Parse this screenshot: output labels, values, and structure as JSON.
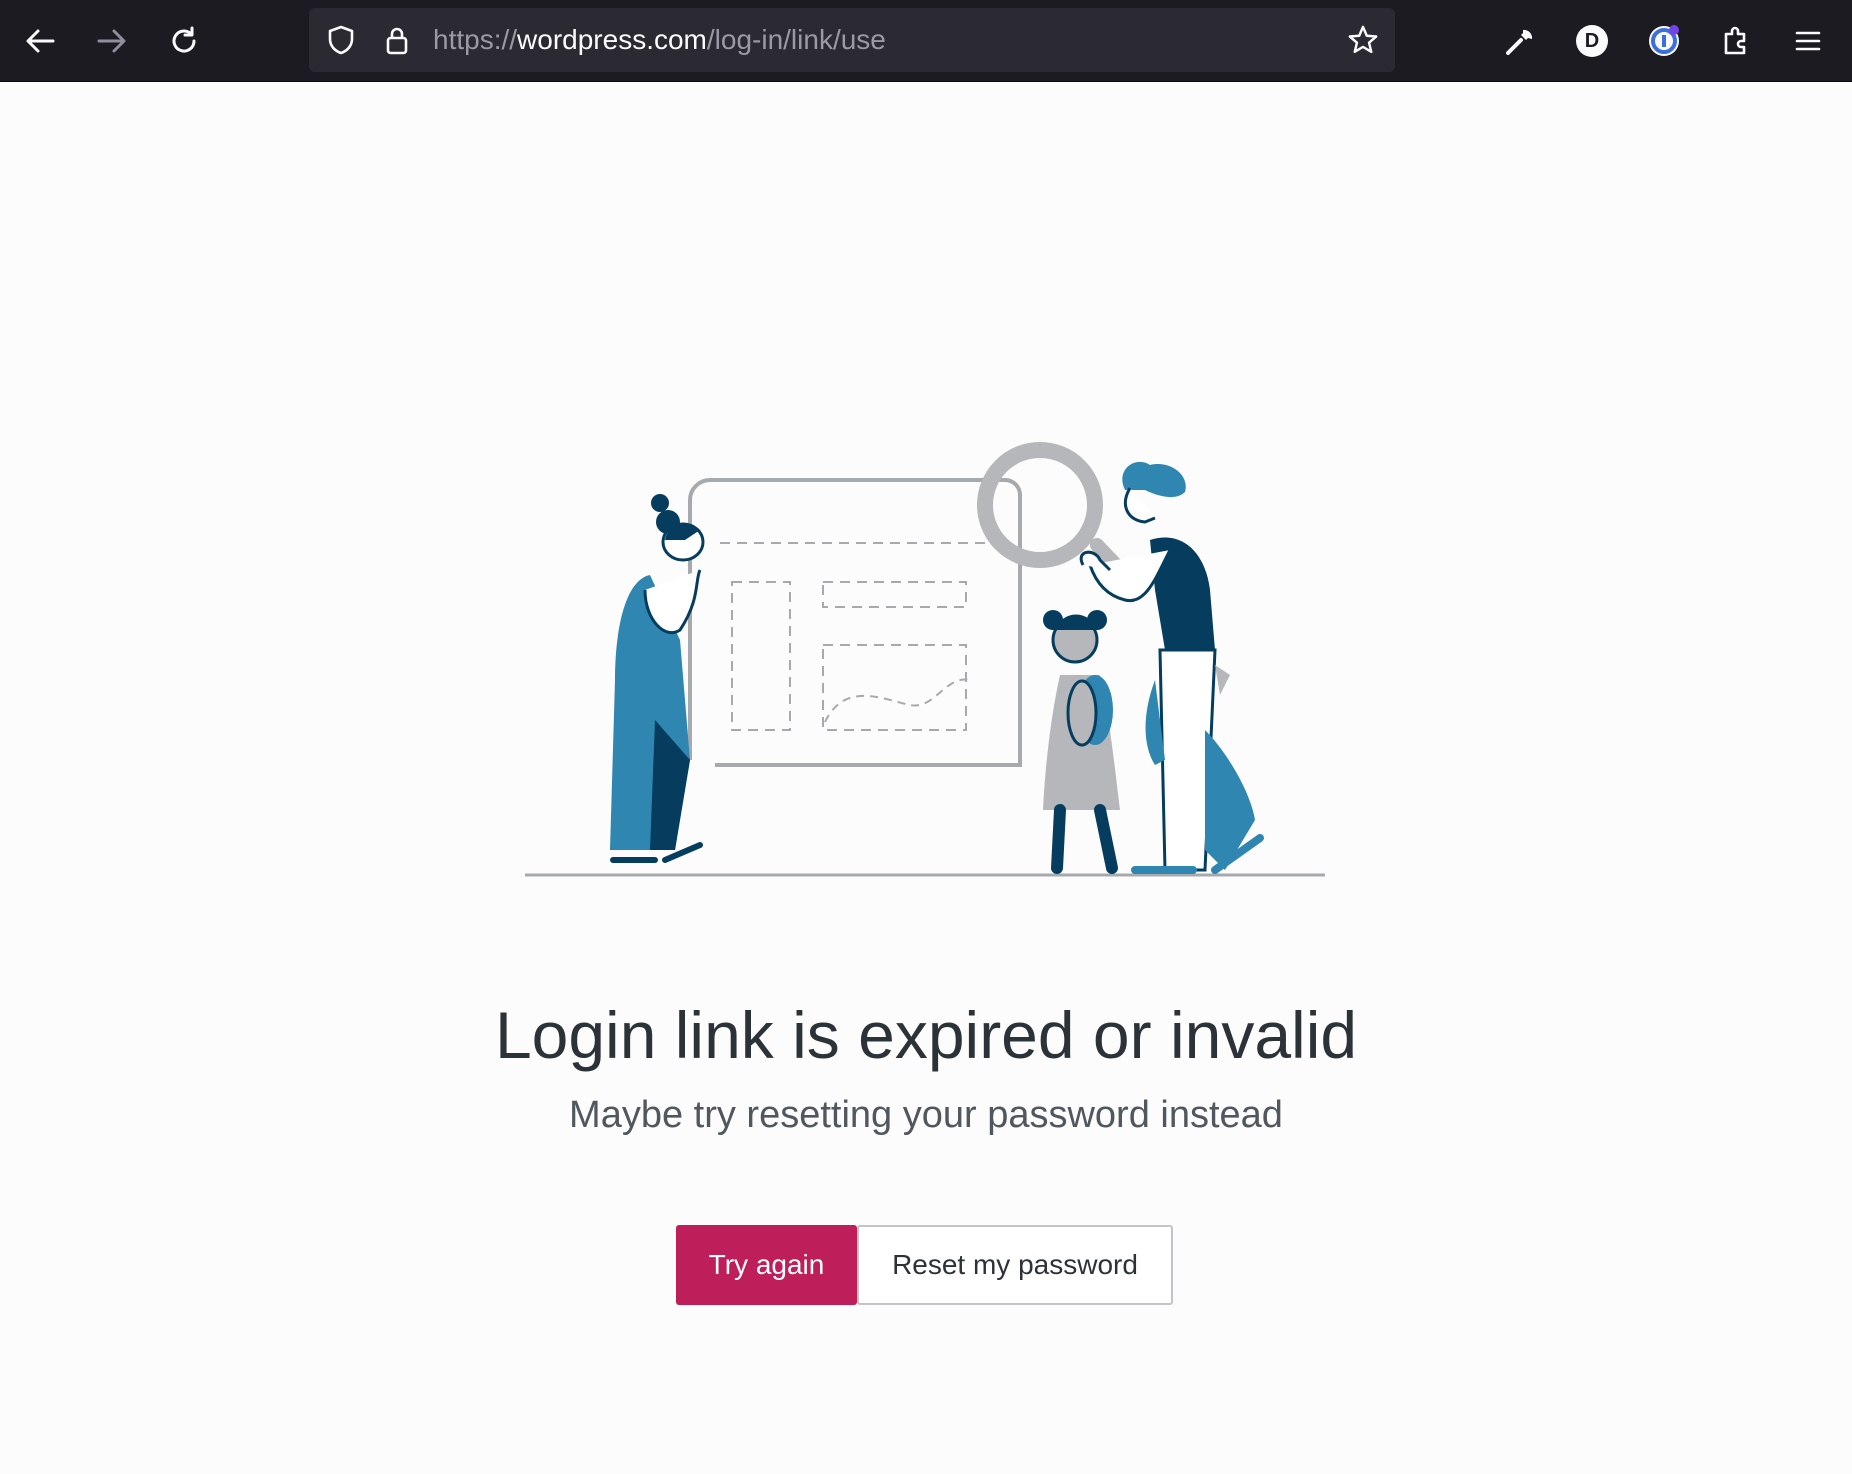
{
  "browser": {
    "url_scheme": "https://",
    "url_host": "wordpress.com",
    "url_path": "/log-in/link/use",
    "profile_initial": "D"
  },
  "icons": {
    "back": "arrow-left-icon",
    "forward": "arrow-right-icon",
    "reload": "reload-icon",
    "shield": "shield-icon",
    "lock": "lock-icon",
    "bookmark": "star-icon",
    "tools": "wrench-icon",
    "profile": "avatar-icon",
    "extension_badge": "circle-extension-icon",
    "extensions": "puzzle-icon",
    "menu": "hamburger-icon"
  },
  "page": {
    "title": "Login link is expired or invalid",
    "subtitle": "Maybe try resetting your password instead",
    "primary_button": "Try again",
    "secondary_button": "Reset my password"
  },
  "colors": {
    "primary": "#be1e5a",
    "illustration_dark": "#063d5e",
    "illustration_blue": "#2f86b1",
    "illustration_gray": "#b5b7ba"
  }
}
